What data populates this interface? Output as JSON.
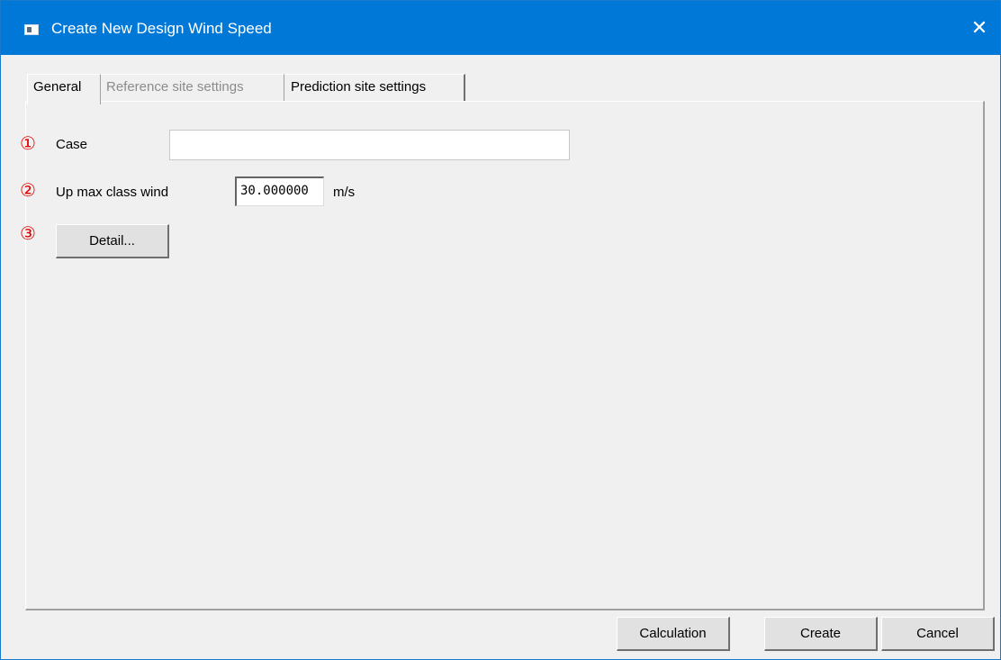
{
  "window": {
    "title": "Create New Design Wind Speed",
    "close_glyph": "✕"
  },
  "tabs": [
    {
      "label": "General",
      "state": "active"
    },
    {
      "label": "Reference site settings",
      "state": "disabled"
    },
    {
      "label": "Prediction site settings",
      "state": "normal"
    }
  ],
  "form": {
    "case": {
      "marker": "①",
      "label": "Case",
      "value": ""
    },
    "up_max": {
      "marker": "②",
      "label": "Up max class wind",
      "value": "30.000000",
      "unit": "m/s"
    },
    "detail": {
      "marker": "③",
      "button_label": "Detail..."
    }
  },
  "footer": {
    "calculation": "Calculation",
    "create": "Create",
    "cancel": "Cancel"
  },
  "colors": {
    "titlebar": "#0078d7",
    "marker_red": "#e00000",
    "disabled_text": "#8c8c8c"
  },
  "icons": {
    "app": "window-app-icon",
    "close": "close-icon"
  }
}
